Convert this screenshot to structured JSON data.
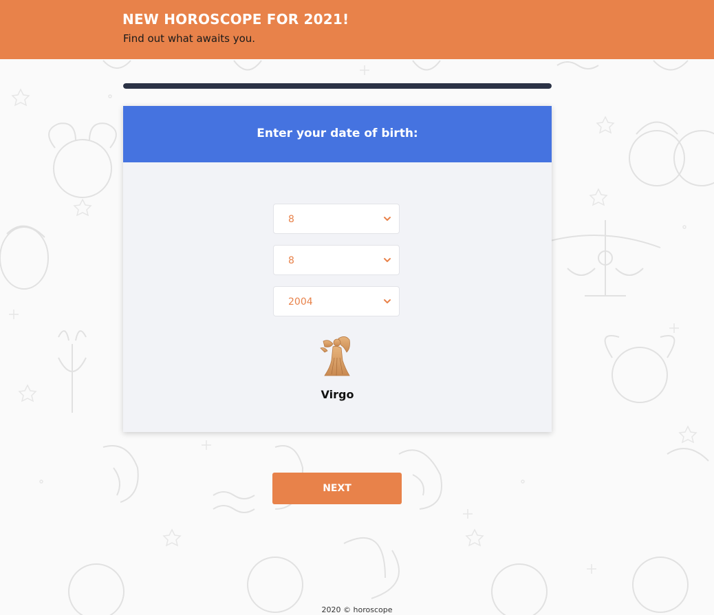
{
  "header": {
    "title": "NEW HOROSCOPE FOR 2021!",
    "subtitle": "Find out what awaits you."
  },
  "progress": {
    "value": 1.0
  },
  "form": {
    "title": "Enter your date of birth:",
    "day": {
      "value": "8"
    },
    "month": {
      "value": "8"
    },
    "year": {
      "value": "2004"
    }
  },
  "sign": {
    "name": "Virgo",
    "icon": "virgo-icon"
  },
  "next_button": {
    "label": "NEXT"
  },
  "footer": {
    "text": "2020 © horoscope"
  },
  "colors": {
    "accent": "#e8824a",
    "header_blue": "#4573e0",
    "progress": "#2b3245",
    "card_bg": "#f2f3f7"
  }
}
